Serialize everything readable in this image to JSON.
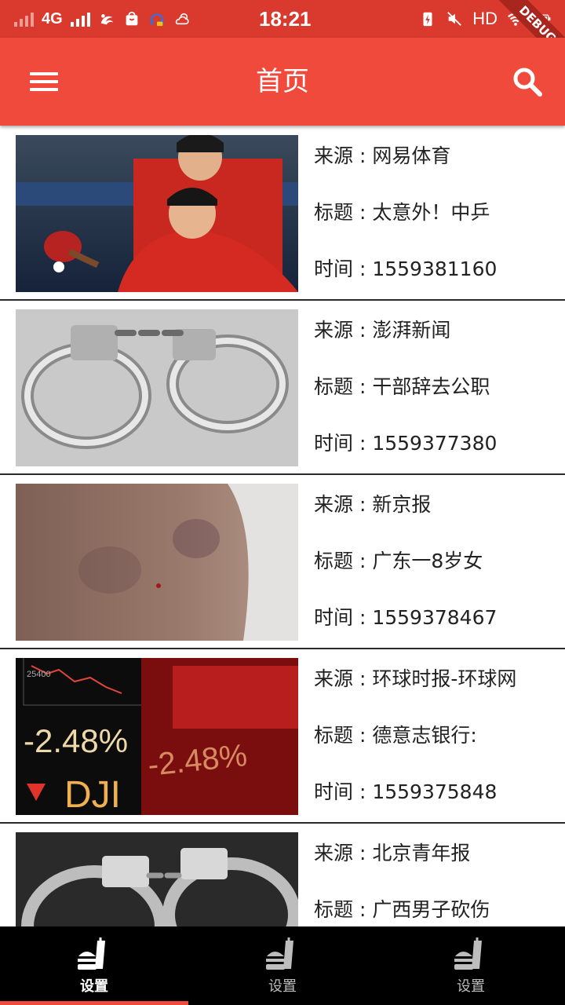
{
  "status_bar": {
    "network": "4G",
    "time": "18:21",
    "hd": "HD",
    "debug": "DEBUG"
  },
  "app_bar": {
    "title": "首页"
  },
  "news": [
    {
      "source": "来源 : 网易体育",
      "title": "标题 : 太意外！中乒",
      "time": "时间 : 1559381160"
    },
    {
      "source": "来源 : 澎湃新闻",
      "title": "标题 : 干部辞去公职",
      "time": "时间 : 1559377380"
    },
    {
      "source": "来源 : 新京报",
      "title": "标题 : 广东一8岁女",
      "time": "时间 : 1559378467"
    },
    {
      "source": "来源 : 环球时报-环球网",
      "title": "标题 : 德意志银行:",
      "time": "时间 : 1559375848"
    },
    {
      "source": "来源 : 北京青年报",
      "title": "标题 : 广西男子砍伤",
      "time": ""
    }
  ],
  "thumb_text": {
    "pct_big": "-2.48%",
    "pct_small": "-2.48%",
    "ticker": "DJI",
    "axis_value": "25400"
  },
  "bottom_nav": {
    "tabs": [
      {
        "label": "设置"
      },
      {
        "label": "设置"
      },
      {
        "label": "设置"
      }
    ]
  },
  "colors": {
    "status_bar": "#d93a2d",
    "app_bar": "#ef4a3c",
    "bottom_nav": "#000000",
    "indicator": "#ef4a3c"
  }
}
